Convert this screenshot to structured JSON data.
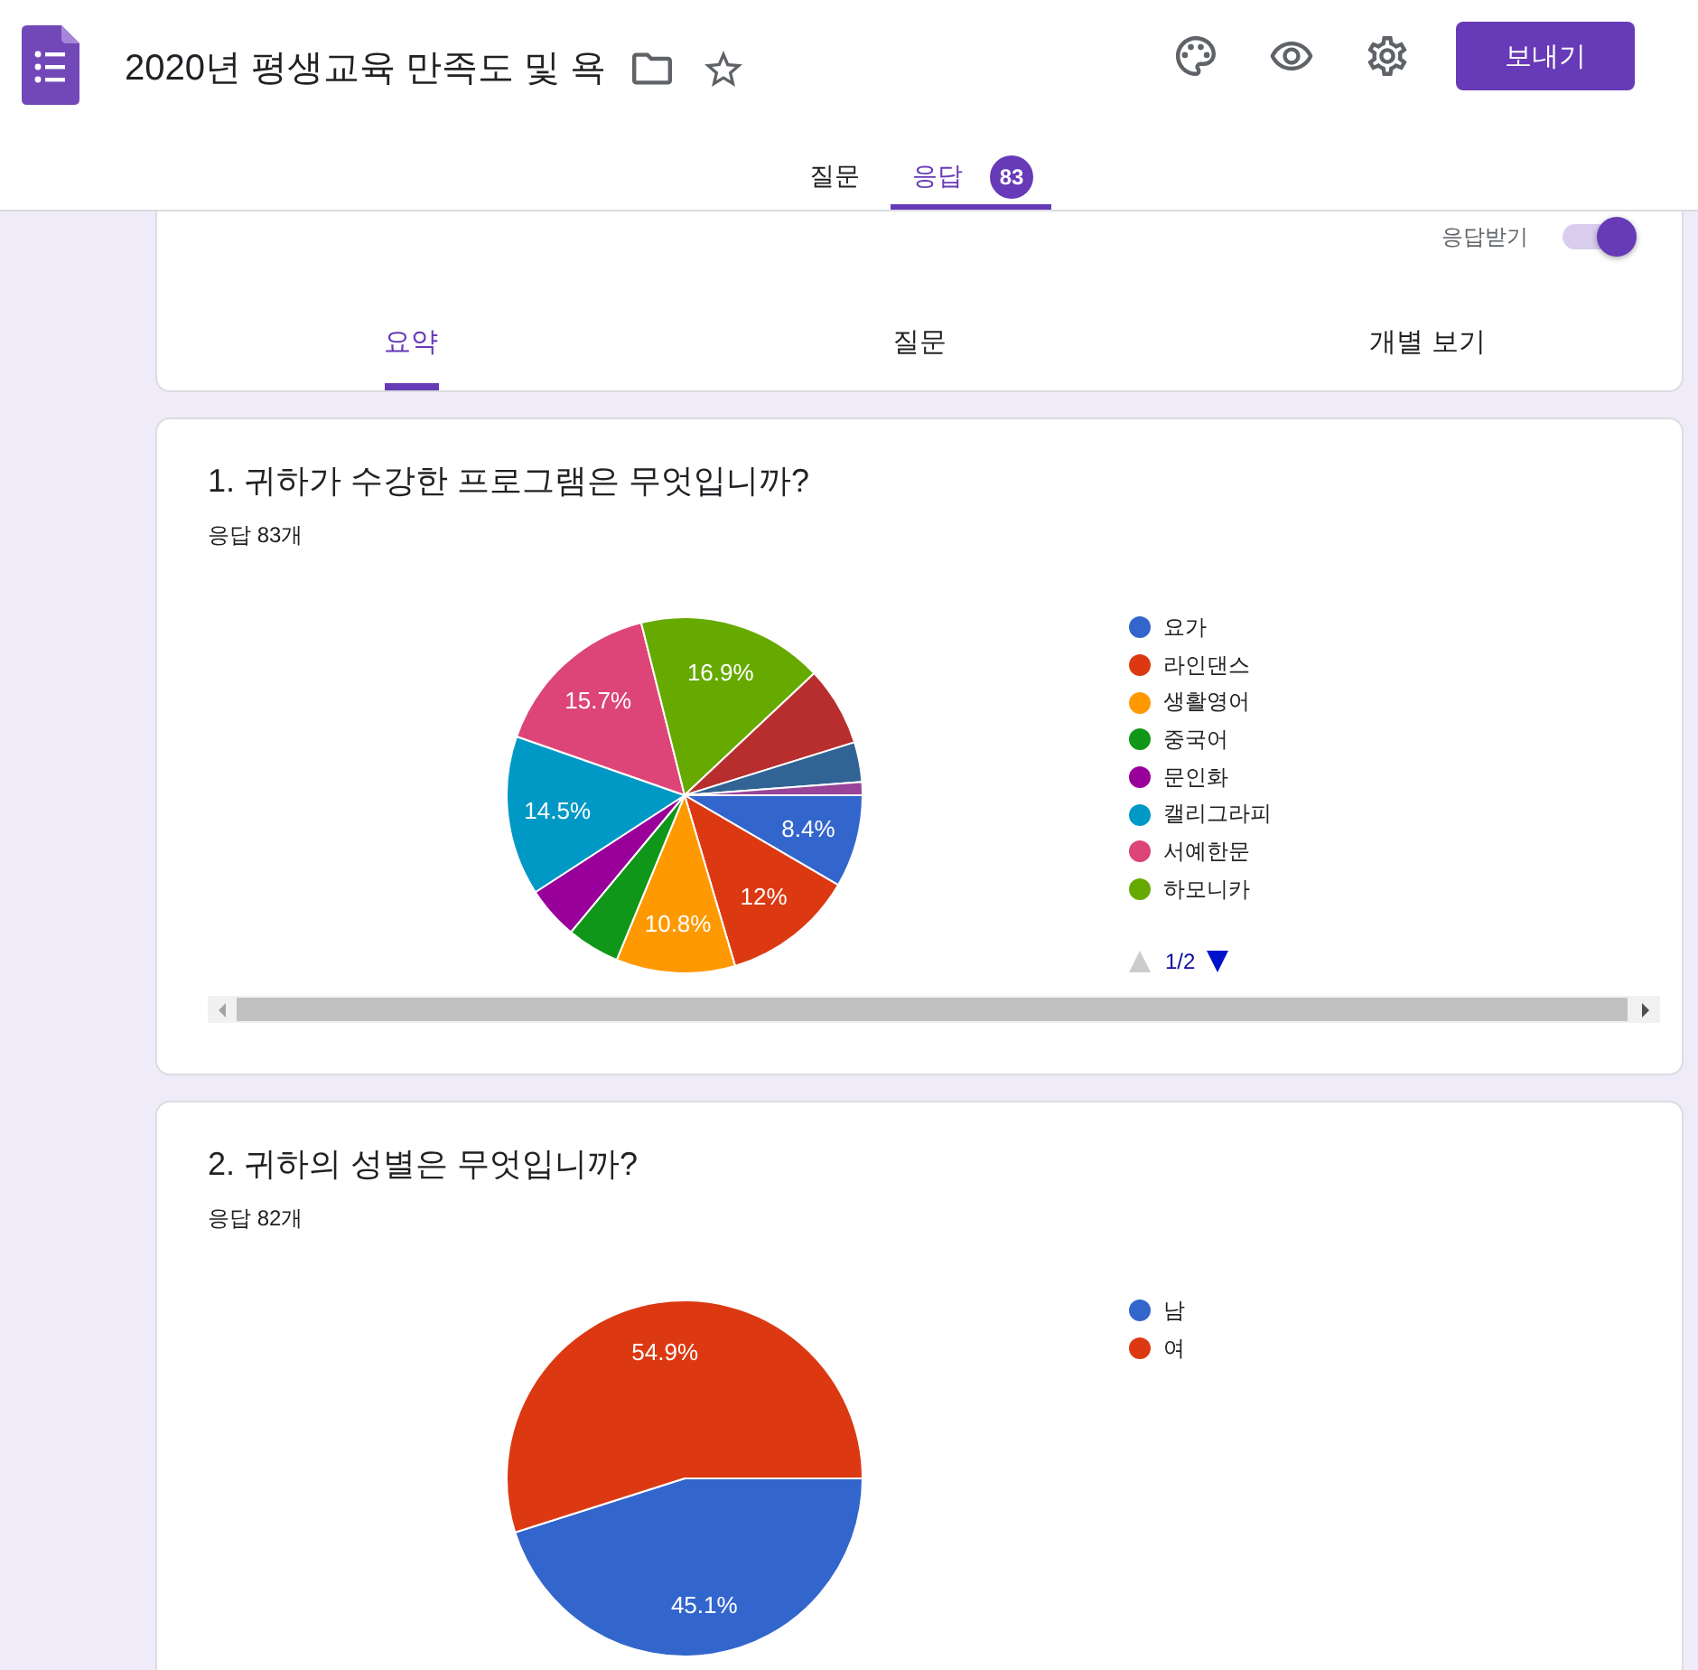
{
  "app": {
    "title": "2020년 평생교육 만족도 및 욕",
    "send_button": "보내기"
  },
  "tabs": [
    {
      "label": "질문",
      "selected": false
    },
    {
      "label": "응답",
      "selected": true,
      "badge": "83"
    }
  ],
  "responses_panel": {
    "accepting": {
      "label": "응답받기",
      "on": true
    },
    "tabs": [
      {
        "label": "요약",
        "selected": true
      },
      {
        "label": "질문",
        "selected": false
      },
      {
        "label": "개별 보기",
        "selected": false
      }
    ]
  },
  "questions": [
    {
      "title": "1. 귀하가 수강한 프로그램은 무엇입니까?",
      "response_count": "응답 83개",
      "chart_data": {
        "type": "pie",
        "categories": [
          "요가",
          "라인댄스",
          "생활영어",
          "중국어",
          "문인화",
          "캘리그라피",
          "서예한문",
          "하모니카",
          null,
          null,
          null
        ],
        "values": [
          8.4,
          12,
          10.8,
          4.8,
          4.8,
          14.5,
          15.7,
          16.9,
          7.2,
          3.6,
          1.2
        ],
        "colors": [
          "#3366cc",
          "#dc3912",
          "#ff9900",
          "#109618",
          "#990099",
          "#0099c6",
          "#dd4477",
          "#66aa00",
          "#b82e2e",
          "#316395",
          "#994499"
        ],
        "value_labels": [
          "8.4%",
          "12%",
          "10.8%",
          null,
          null,
          "14.5%",
          "15.7%",
          "16.9%",
          null,
          null,
          null
        ]
      },
      "legend_pager": {
        "label": "1/2",
        "prev_disabled": true,
        "next_disabled": false
      },
      "horizontal_scrollbar": true
    },
    {
      "title": "2. 귀하의 성별은 무엇입니까?",
      "response_count": "응답 82개",
      "chart_data": {
        "type": "pie",
        "categories": [
          "남",
          "여"
        ],
        "values": [
          45.1,
          54.9
        ],
        "colors": [
          "#3366cc",
          "#dc3912"
        ],
        "value_labels": [
          "45.1%",
          "54.9%"
        ]
      }
    }
  ]
}
